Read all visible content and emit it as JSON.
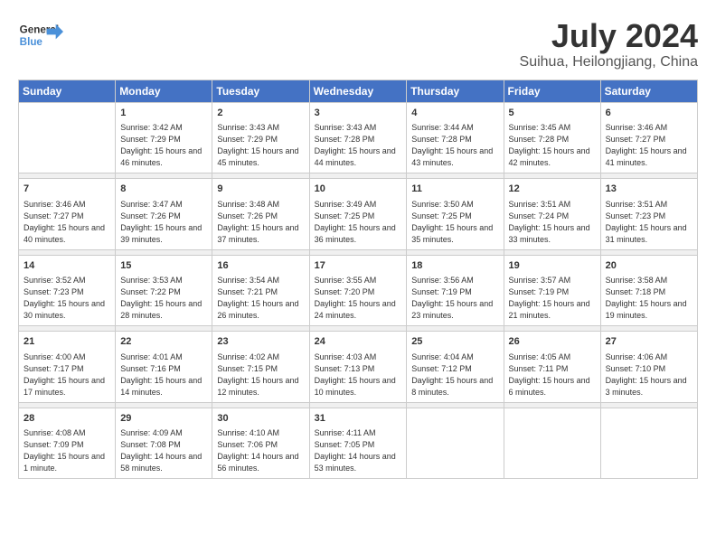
{
  "header": {
    "logo_general": "General",
    "logo_blue": "Blue",
    "month": "July 2024",
    "location": "Suihua, Heilongjiang, China"
  },
  "days_of_week": [
    "Sunday",
    "Monday",
    "Tuesday",
    "Wednesday",
    "Thursday",
    "Friday",
    "Saturday"
  ],
  "weeks": [
    [
      {
        "day": "",
        "sunrise": "",
        "sunset": "",
        "daylight": ""
      },
      {
        "day": "1",
        "sunrise": "Sunrise: 3:42 AM",
        "sunset": "Sunset: 7:29 PM",
        "daylight": "Daylight: 15 hours and 46 minutes."
      },
      {
        "day": "2",
        "sunrise": "Sunrise: 3:43 AM",
        "sunset": "Sunset: 7:29 PM",
        "daylight": "Daylight: 15 hours and 45 minutes."
      },
      {
        "day": "3",
        "sunrise": "Sunrise: 3:43 AM",
        "sunset": "Sunset: 7:28 PM",
        "daylight": "Daylight: 15 hours and 44 minutes."
      },
      {
        "day": "4",
        "sunrise": "Sunrise: 3:44 AM",
        "sunset": "Sunset: 7:28 PM",
        "daylight": "Daylight: 15 hours and 43 minutes."
      },
      {
        "day": "5",
        "sunrise": "Sunrise: 3:45 AM",
        "sunset": "Sunset: 7:28 PM",
        "daylight": "Daylight: 15 hours and 42 minutes."
      },
      {
        "day": "6",
        "sunrise": "Sunrise: 3:46 AM",
        "sunset": "Sunset: 7:27 PM",
        "daylight": "Daylight: 15 hours and 41 minutes."
      }
    ],
    [
      {
        "day": "7",
        "sunrise": "Sunrise: 3:46 AM",
        "sunset": "Sunset: 7:27 PM",
        "daylight": "Daylight: 15 hours and 40 minutes."
      },
      {
        "day": "8",
        "sunrise": "Sunrise: 3:47 AM",
        "sunset": "Sunset: 7:26 PM",
        "daylight": "Daylight: 15 hours and 39 minutes."
      },
      {
        "day": "9",
        "sunrise": "Sunrise: 3:48 AM",
        "sunset": "Sunset: 7:26 PM",
        "daylight": "Daylight: 15 hours and 37 minutes."
      },
      {
        "day": "10",
        "sunrise": "Sunrise: 3:49 AM",
        "sunset": "Sunset: 7:25 PM",
        "daylight": "Daylight: 15 hours and 36 minutes."
      },
      {
        "day": "11",
        "sunrise": "Sunrise: 3:50 AM",
        "sunset": "Sunset: 7:25 PM",
        "daylight": "Daylight: 15 hours and 35 minutes."
      },
      {
        "day": "12",
        "sunrise": "Sunrise: 3:51 AM",
        "sunset": "Sunset: 7:24 PM",
        "daylight": "Daylight: 15 hours and 33 minutes."
      },
      {
        "day": "13",
        "sunrise": "Sunrise: 3:51 AM",
        "sunset": "Sunset: 7:23 PM",
        "daylight": "Daylight: 15 hours and 31 minutes."
      }
    ],
    [
      {
        "day": "14",
        "sunrise": "Sunrise: 3:52 AM",
        "sunset": "Sunset: 7:23 PM",
        "daylight": "Daylight: 15 hours and 30 minutes."
      },
      {
        "day": "15",
        "sunrise": "Sunrise: 3:53 AM",
        "sunset": "Sunset: 7:22 PM",
        "daylight": "Daylight: 15 hours and 28 minutes."
      },
      {
        "day": "16",
        "sunrise": "Sunrise: 3:54 AM",
        "sunset": "Sunset: 7:21 PM",
        "daylight": "Daylight: 15 hours and 26 minutes."
      },
      {
        "day": "17",
        "sunrise": "Sunrise: 3:55 AM",
        "sunset": "Sunset: 7:20 PM",
        "daylight": "Daylight: 15 hours and 24 minutes."
      },
      {
        "day": "18",
        "sunrise": "Sunrise: 3:56 AM",
        "sunset": "Sunset: 7:19 PM",
        "daylight": "Daylight: 15 hours and 23 minutes."
      },
      {
        "day": "19",
        "sunrise": "Sunrise: 3:57 AM",
        "sunset": "Sunset: 7:19 PM",
        "daylight": "Daylight: 15 hours and 21 minutes."
      },
      {
        "day": "20",
        "sunrise": "Sunrise: 3:58 AM",
        "sunset": "Sunset: 7:18 PM",
        "daylight": "Daylight: 15 hours and 19 minutes."
      }
    ],
    [
      {
        "day": "21",
        "sunrise": "Sunrise: 4:00 AM",
        "sunset": "Sunset: 7:17 PM",
        "daylight": "Daylight: 15 hours and 17 minutes."
      },
      {
        "day": "22",
        "sunrise": "Sunrise: 4:01 AM",
        "sunset": "Sunset: 7:16 PM",
        "daylight": "Daylight: 15 hours and 14 minutes."
      },
      {
        "day": "23",
        "sunrise": "Sunrise: 4:02 AM",
        "sunset": "Sunset: 7:15 PM",
        "daylight": "Daylight: 15 hours and 12 minutes."
      },
      {
        "day": "24",
        "sunrise": "Sunrise: 4:03 AM",
        "sunset": "Sunset: 7:13 PM",
        "daylight": "Daylight: 15 hours and 10 minutes."
      },
      {
        "day": "25",
        "sunrise": "Sunrise: 4:04 AM",
        "sunset": "Sunset: 7:12 PM",
        "daylight": "Daylight: 15 hours and 8 minutes."
      },
      {
        "day": "26",
        "sunrise": "Sunrise: 4:05 AM",
        "sunset": "Sunset: 7:11 PM",
        "daylight": "Daylight: 15 hours and 6 minutes."
      },
      {
        "day": "27",
        "sunrise": "Sunrise: 4:06 AM",
        "sunset": "Sunset: 7:10 PM",
        "daylight": "Daylight: 15 hours and 3 minutes."
      }
    ],
    [
      {
        "day": "28",
        "sunrise": "Sunrise: 4:08 AM",
        "sunset": "Sunset: 7:09 PM",
        "daylight": "Daylight: 15 hours and 1 minute."
      },
      {
        "day": "29",
        "sunrise": "Sunrise: 4:09 AM",
        "sunset": "Sunset: 7:08 PM",
        "daylight": "Daylight: 14 hours and 58 minutes."
      },
      {
        "day": "30",
        "sunrise": "Sunrise: 4:10 AM",
        "sunset": "Sunset: 7:06 PM",
        "daylight": "Daylight: 14 hours and 56 minutes."
      },
      {
        "day": "31",
        "sunrise": "Sunrise: 4:11 AM",
        "sunset": "Sunset: 7:05 PM",
        "daylight": "Daylight: 14 hours and 53 minutes."
      },
      {
        "day": "",
        "sunrise": "",
        "sunset": "",
        "daylight": ""
      },
      {
        "day": "",
        "sunrise": "",
        "sunset": "",
        "daylight": ""
      },
      {
        "day": "",
        "sunrise": "",
        "sunset": "",
        "daylight": ""
      }
    ]
  ]
}
